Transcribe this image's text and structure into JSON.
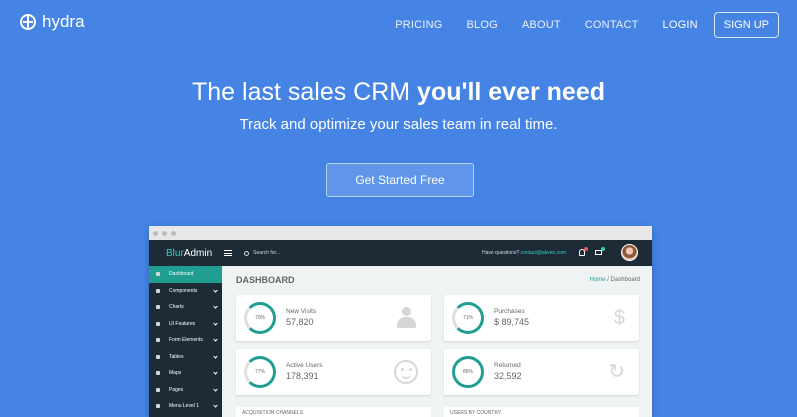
{
  "brand": {
    "name": "hydra"
  },
  "nav": {
    "pricing": "PRICING",
    "blog": "BLOG",
    "about": "ABOUT",
    "contact": "CONTACT",
    "login": "LOGIN",
    "signup": "SIGN UP"
  },
  "hero": {
    "title_plain": "The last sales CRM ",
    "title_bold": "you'll ever need",
    "subtitle": "Track and optimize your sales team in real time.",
    "cta": "Get Started Free"
  },
  "mockup": {
    "logo_blur": "Blur",
    "logo_admin": "Admin",
    "search_placeholder": "Search for...",
    "questions": "Have questions?",
    "contact_email": "contact@akveo.com",
    "sidebar": [
      {
        "label": "Dashboard",
        "active": true
      },
      {
        "label": "Components"
      },
      {
        "label": "Charts"
      },
      {
        "label": "UI Features"
      },
      {
        "label": "Form Elements"
      },
      {
        "label": "Tables"
      },
      {
        "label": "Maps"
      },
      {
        "label": "Pages"
      },
      {
        "label": "Menu Level 1"
      }
    ],
    "page_title": "DASHBOARD",
    "breadcrumb": {
      "home": "Home",
      "sep": "/",
      "current": "Dashboard"
    },
    "cards": [
      {
        "percent": "70%",
        "label": "New Visits",
        "value": "57,820",
        "icon": "person-icon"
      },
      {
        "percent": "71%",
        "label": "Purchases",
        "value": "$ 89,745",
        "icon": "dollar-icon"
      },
      {
        "percent": "77%",
        "label": "Active Users",
        "value": "178,391",
        "icon": "smile-icon"
      },
      {
        "percent": "86%",
        "label": "Returned",
        "value": "32,592",
        "icon": "refresh-icon"
      }
    ],
    "sections": {
      "acquisition": "ACQUISITION CHANNELS",
      "users_by_country": "USERS BY COUNTRY"
    }
  }
}
